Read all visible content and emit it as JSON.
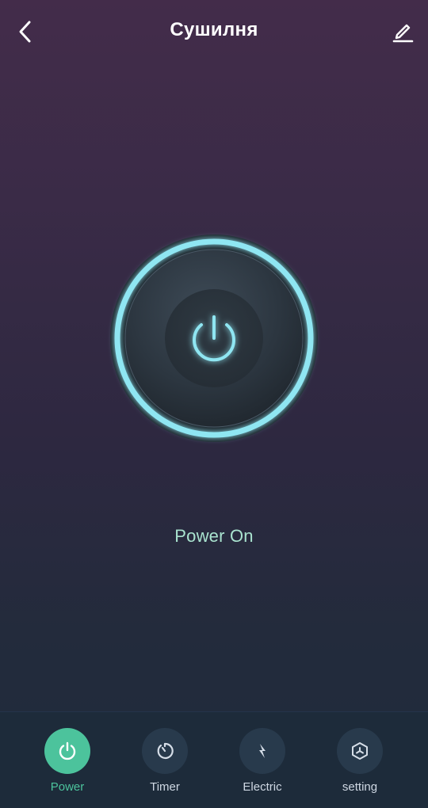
{
  "header": {
    "title": "Сушилня",
    "back_icon": "chevron-left-icon",
    "edit_icon": "pencil-edit-icon"
  },
  "power": {
    "state": "on",
    "status_text": "Power On",
    "icon": "power-icon",
    "ring_color": "#8fe6f2"
  },
  "tabs": [
    {
      "label": "Power",
      "icon": "power-icon",
      "active": true
    },
    {
      "label": "Timer",
      "icon": "timer-icon",
      "active": false
    },
    {
      "label": "Electric",
      "icon": "lightning-icon",
      "active": false
    },
    {
      "label": "setting",
      "icon": "cube-setting-icon",
      "active": false
    }
  ],
  "colors": {
    "accent": "#4cc39c",
    "status_text": "#a9e3cf",
    "tab_bar": "#1d2b3a"
  }
}
